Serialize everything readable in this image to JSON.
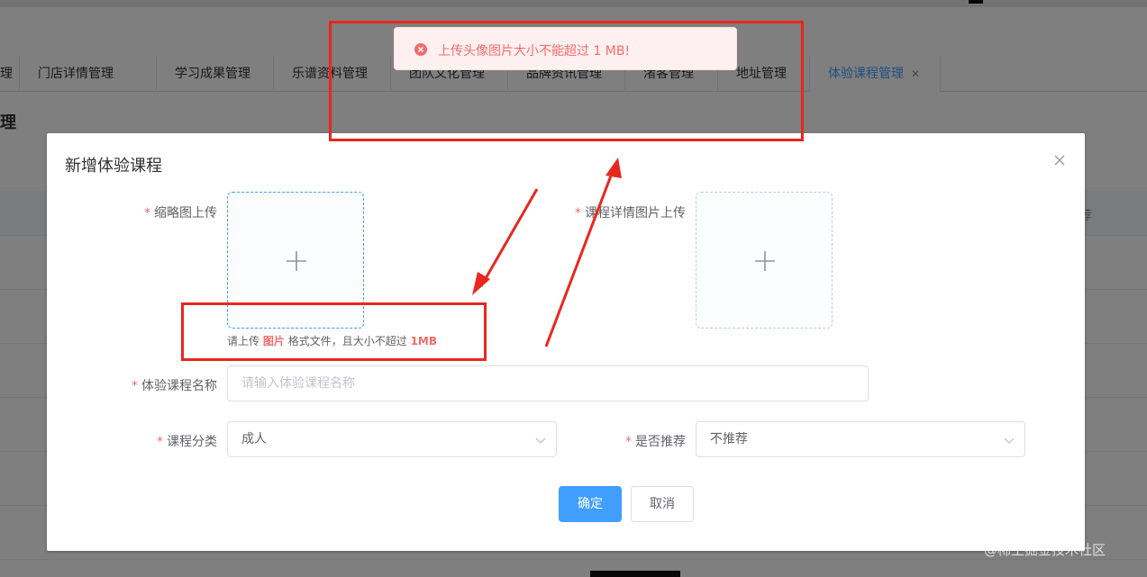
{
  "background": {
    "tabs": [
      {
        "label": "管理"
      },
      {
        "label": "门店详情管理"
      },
      {
        "label": "学习成果管理"
      },
      {
        "label": "乐谱资料管理"
      },
      {
        "label": "团队文化管理"
      },
      {
        "label": "品牌资讯管理"
      },
      {
        "label": "渚客管理"
      },
      {
        "label": "地址管理"
      },
      {
        "label": "体验课程管理",
        "active": true
      }
    ],
    "page_title": "理",
    "table_header_right": "荐"
  },
  "toast": {
    "message": "上传头像图片大小不能超过 1 MB!",
    "color": "#f56c6c"
  },
  "dialog": {
    "title": "新增体验课程",
    "thumbnail_label": "缩略图上传",
    "thumbnail_tip_prefix": "请上传",
    "thumbnail_tip_type": "图片",
    "thumbnail_tip_middle": "格式文件，且大小不超过",
    "thumbnail_tip_size": "1MB",
    "detail_label": "课程详情图片上传",
    "name_label": "体验课程名称",
    "name_placeholder": "请输入体验课程名称",
    "category_label": "课程分类",
    "category_value": "成人",
    "recommend_label": "是否推荐",
    "recommend_value": "不推荐",
    "confirm_label": "确定",
    "cancel_label": "取消"
  },
  "annotation_color": "#e8271d",
  "watermark": "@稀土掘金技术社区"
}
